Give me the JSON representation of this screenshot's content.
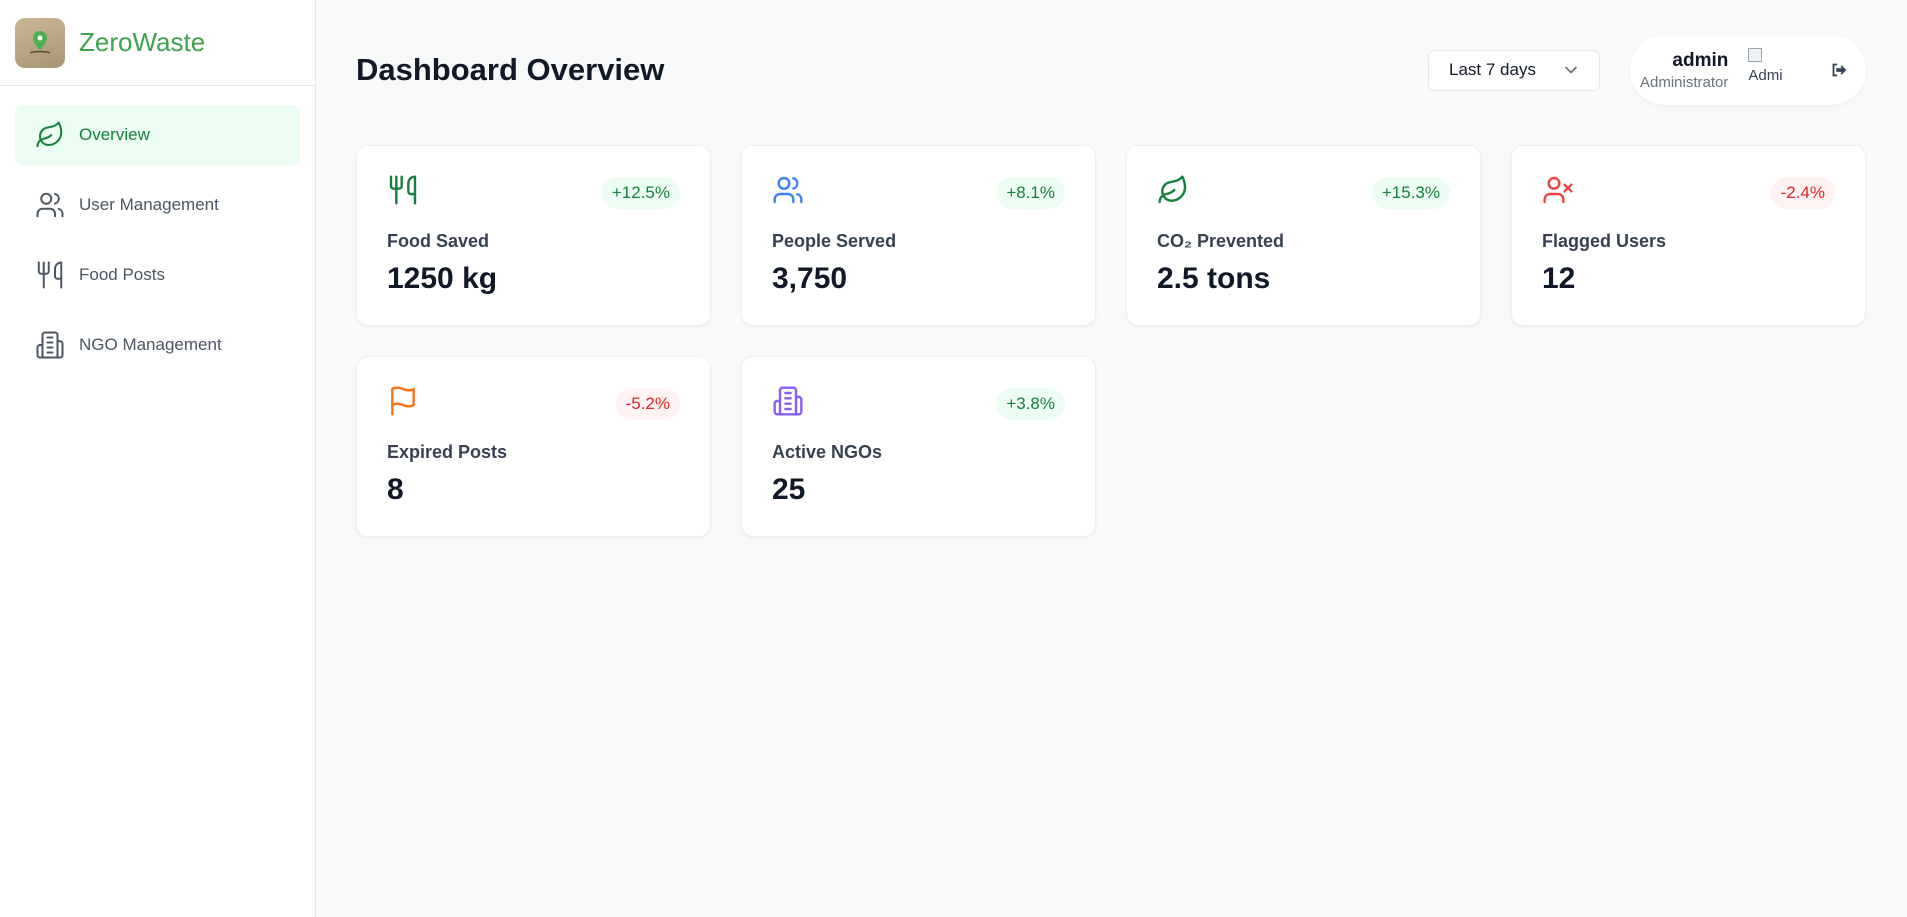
{
  "brand": {
    "name": "ZeroWaste"
  },
  "sidebar": {
    "items": [
      {
        "label": "Overview",
        "icon": "leaf-icon",
        "active": true
      },
      {
        "label": "User Management",
        "icon": "users-icon",
        "active": false
      },
      {
        "label": "Food Posts",
        "icon": "utensils-icon",
        "active": false
      },
      {
        "label": "NGO Management",
        "icon": "building-icon",
        "active": false
      }
    ]
  },
  "header": {
    "title": "Dashboard Overview",
    "range": {
      "selected": "Last 7 days"
    },
    "user": {
      "name": "admin",
      "role": "Administrator",
      "avatar_alt": "Admi"
    }
  },
  "stats": [
    {
      "label": "Food Saved",
      "value": "1250 kg",
      "change": "+12.5%",
      "trend": "up",
      "icon": "utensils-icon",
      "color": "#15803d"
    },
    {
      "label": "People Served",
      "value": "3,750",
      "change": "+8.1%",
      "trend": "up",
      "icon": "users-icon",
      "color": "#3b82f6"
    },
    {
      "label": "CO₂ Prevented",
      "value": "2.5 tons",
      "change": "+15.3%",
      "trend": "up",
      "icon": "leaf-icon",
      "color": "#15803d"
    },
    {
      "label": "Flagged Users",
      "value": "12",
      "change": "-2.4%",
      "trend": "down",
      "icon": "user-x-icon",
      "color": "#ef4444"
    },
    {
      "label": "Expired Posts",
      "value": "8",
      "change": "-5.2%",
      "trend": "down",
      "icon": "flag-icon",
      "color": "#f97316"
    },
    {
      "label": "Active NGOs",
      "value": "25",
      "change": "+3.8%",
      "trend": "up",
      "icon": "building-icon",
      "color": "#8b5cf6"
    }
  ],
  "colors": {
    "accent": "#3fa34d",
    "active_bg": "#ecfdf3",
    "badge_up": "#15803d",
    "badge_down": "#dc2626"
  }
}
